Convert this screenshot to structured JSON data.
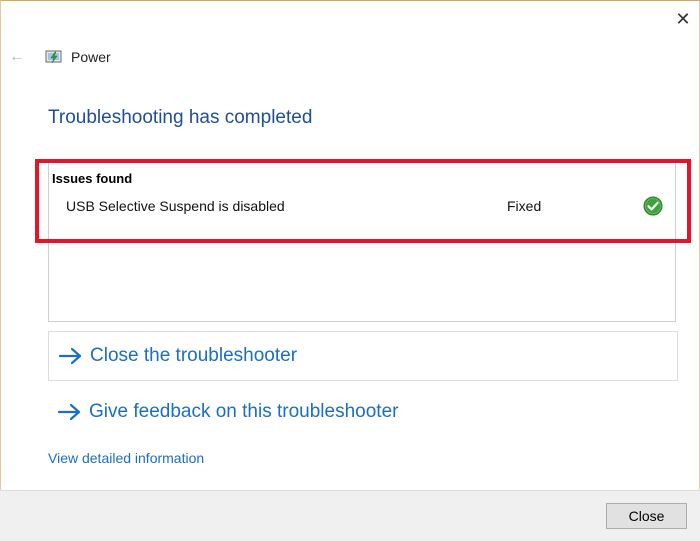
{
  "window": {
    "title": "Power",
    "close_glyph": "✕",
    "back_glyph": "←",
    "app_icon": "power-options-icon"
  },
  "main": {
    "heading": "Troubleshooting has completed",
    "issues": {
      "header": "Issues found",
      "items": [
        {
          "name": "USB Selective Suspend is disabled",
          "status": "Fixed",
          "status_icon": "green-check-icon"
        }
      ]
    },
    "actions": [
      {
        "label": "Close the troubleshooter",
        "icon": "right-arrow-icon"
      },
      {
        "label": "Give feedback on this troubleshooter",
        "icon": "right-arrow-icon"
      }
    ],
    "details_link": "View detailed information"
  },
  "footer": {
    "close_button": "Close"
  },
  "colors": {
    "heading": "#1f4e99",
    "link": "#1a6fc5",
    "highlight": "#e3152b",
    "check": "#3ea33e"
  }
}
